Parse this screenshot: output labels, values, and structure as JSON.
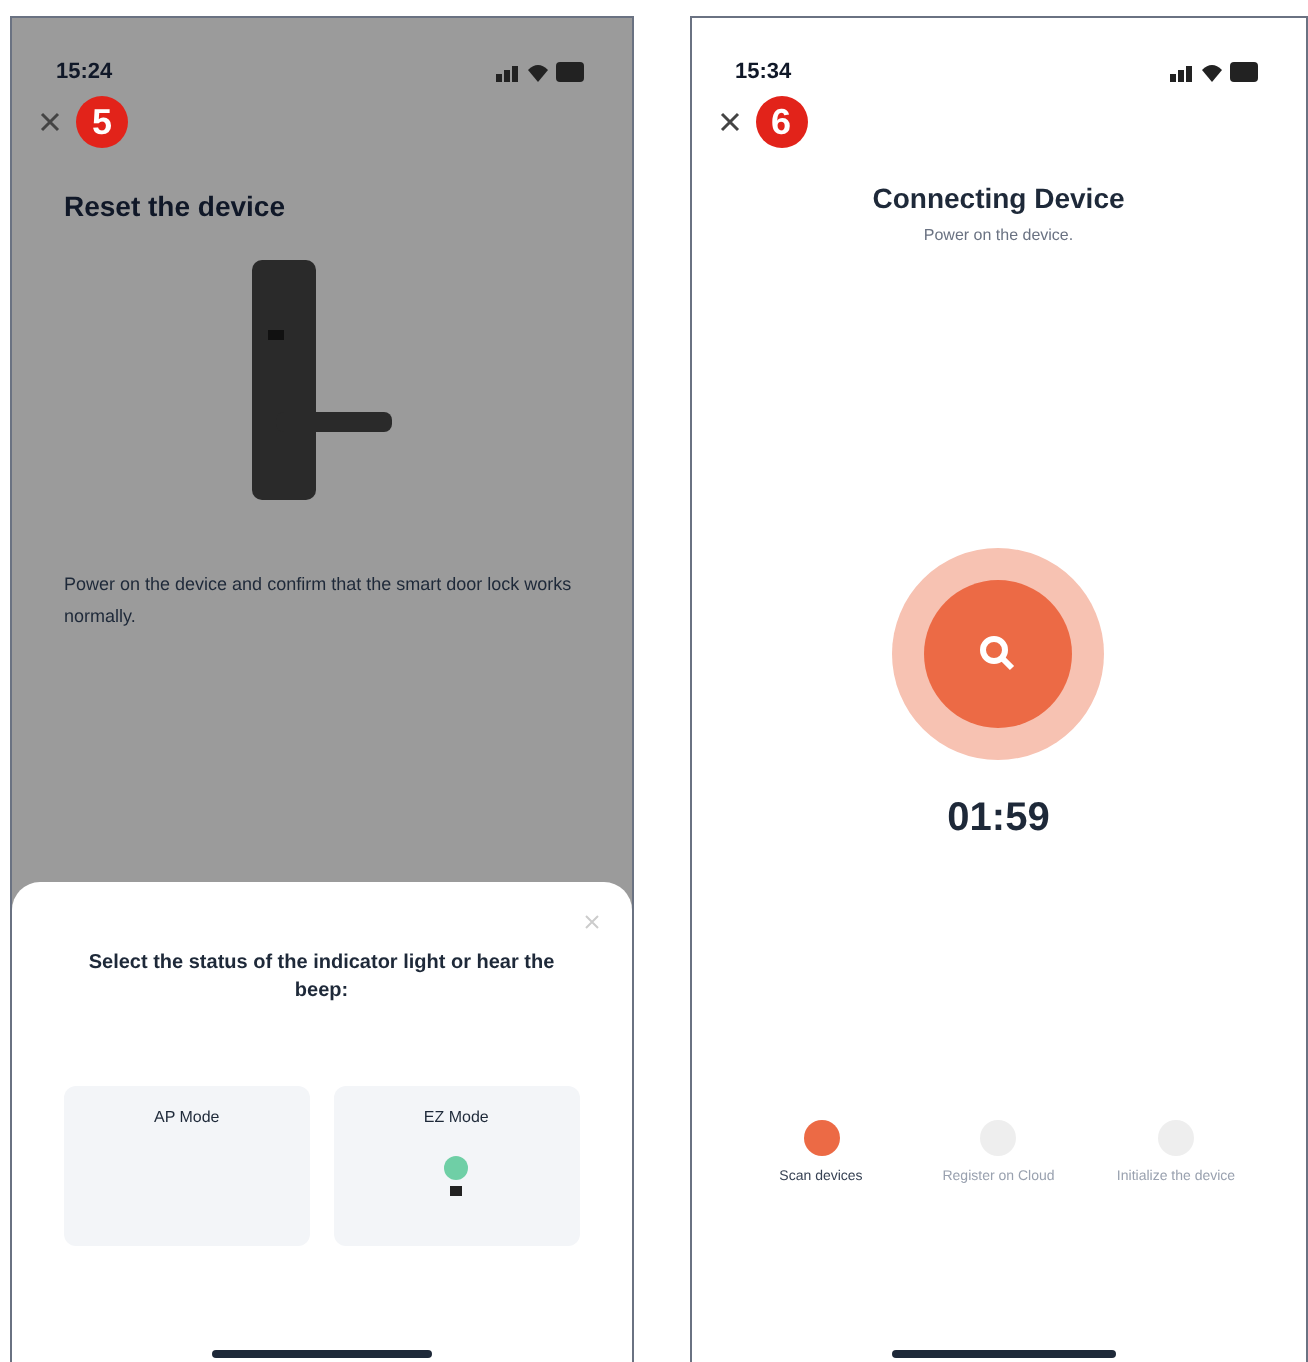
{
  "screens": [
    {
      "kind": "reset",
      "status_bar": {
        "time": "15:24"
      },
      "step_badge": "5",
      "title": "Reset the device",
      "description": "Power on the device and confirm that the smart door lock works normally.",
      "sheet": {
        "title": "Select the status of the indicator light or hear the beep:",
        "modes": [
          {
            "label": "AP Mode",
            "kind": "plain"
          },
          {
            "label": "EZ Mode",
            "kind": "light"
          }
        ]
      }
    },
    {
      "kind": "connecting",
      "status_bar": {
        "time": "15:34"
      },
      "step_badge": "6",
      "title": "Connecting Device",
      "subtitle": "Power on the device.",
      "timer": "01:59",
      "steps": [
        {
          "label": "Scan devices",
          "active": true
        },
        {
          "label": "Register on Cloud",
          "active": false
        },
        {
          "label": "Initialize the device",
          "active": false
        }
      ]
    }
  ]
}
